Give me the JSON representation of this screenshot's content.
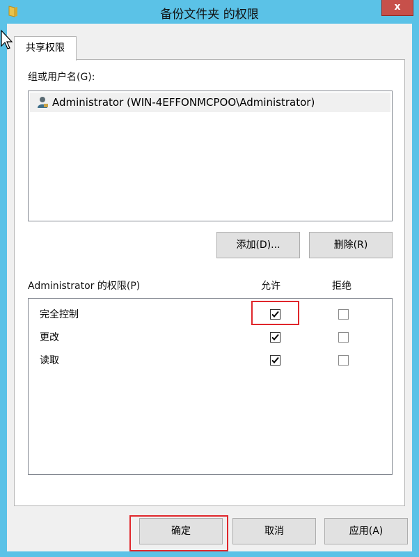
{
  "window": {
    "title": "备份文件夹 的权限",
    "close_label": "x"
  },
  "tabs": [
    {
      "label": "共享权限"
    }
  ],
  "users": {
    "label": "组或用户名(G):",
    "items": [
      {
        "name": "Administrator (WIN-4EFFONMCPOO\\Administrator)"
      }
    ],
    "add_button": "添加(D)...",
    "remove_button": "删除(R)"
  },
  "permissions": {
    "label": "Administrator 的权限(P)",
    "allow_header": "允许",
    "deny_header": "拒绝",
    "rows": [
      {
        "name": "完全控制",
        "allow": true,
        "deny": false
      },
      {
        "name": "更改",
        "allow": true,
        "deny": false
      },
      {
        "name": "读取",
        "allow": true,
        "deny": false
      }
    ]
  },
  "footer": {
    "ok": "确定",
    "cancel": "取消",
    "apply": "应用(A)"
  },
  "colors": {
    "title_bar": "#5bc2e7",
    "close_button": "#c7504a",
    "highlight_box": "#e0262b"
  }
}
